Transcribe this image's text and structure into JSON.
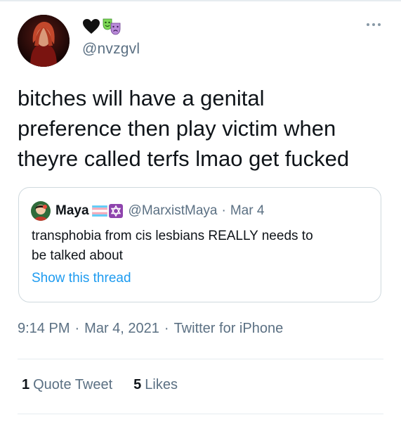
{
  "tweet": {
    "handle": "@nvzgvl",
    "name_emojis": [
      "black-heart-icon",
      "green-comedy-mask-icon",
      "purple-tragedy-mask-icon"
    ],
    "text": "bitches will have a genital\npreference then play victim when\ntheyre called terfs lmao get fucked",
    "time": "9:14 PM",
    "date": "Mar 4, 2021",
    "source": "Twitter for iPhone",
    "separator": "·"
  },
  "quote": {
    "name": "Maya",
    "name_emojis": [
      "transgender-flag-icon",
      "star-of-david-icon"
    ],
    "handle": "@MarxistMaya",
    "separator": "·",
    "date": "Mar 4",
    "text": "transphobia from cis lesbians REALLY needs to\nbe talked about",
    "show_thread": "Show this thread"
  },
  "stats": {
    "quote_count": "1",
    "quote_label": "Quote Tweet",
    "like_count": "5",
    "like_label": "Likes"
  },
  "colors": {
    "text": "#0f1419",
    "secondary": "#5b7083",
    "link": "#1d9bf0",
    "border": "#cfd9de"
  }
}
